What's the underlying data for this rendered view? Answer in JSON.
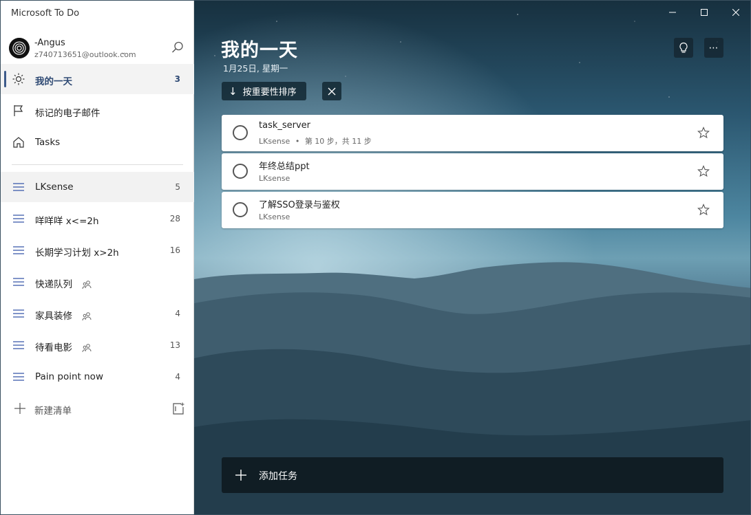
{
  "app_title": "Microsoft To Do",
  "account": {
    "name": "-Angus",
    "email": "z740713651@outlook.com"
  },
  "smart_lists": [
    {
      "label": "我的一天",
      "count": "3",
      "icon": "sun-icon",
      "active": true
    },
    {
      "label": "标记的电子邮件",
      "count": "",
      "icon": "flag-icon",
      "active": false
    },
    {
      "label": "Tasks",
      "count": "",
      "icon": "home-icon",
      "active": false
    }
  ],
  "lists": [
    {
      "label": "LKsense",
      "count": "5",
      "shared": false
    },
    {
      "label": "咩咩咩 x<=2h",
      "count": "28",
      "shared": false
    },
    {
      "label": "长期学习计划 x>2h",
      "count": "16",
      "shared": false
    },
    {
      "label": "快递队列",
      "count": "",
      "shared": true
    },
    {
      "label": "家具装修",
      "count": "4",
      "shared": true
    },
    {
      "label": "待看电影",
      "count": "13",
      "shared": true
    },
    {
      "label": "Pain point now",
      "count": "4",
      "shared": false
    }
  ],
  "new_list_label": "新建清单",
  "main": {
    "title": "我的一天",
    "date": "1月25日, 星期一",
    "sort_label": "按重要性排序",
    "add_task_label": "添加任务"
  },
  "tasks": [
    {
      "title": "task_server",
      "list": "LKsense",
      "steps": "第 10 步，共 11 步"
    },
    {
      "title": "年终总结ppt",
      "list": "LKsense",
      "steps": ""
    },
    {
      "title": "了解SSO登录与鉴权",
      "list": "LKsense",
      "steps": ""
    }
  ],
  "colors": {
    "accent": "#2f4a74",
    "list_icon": "#4a66b0"
  }
}
